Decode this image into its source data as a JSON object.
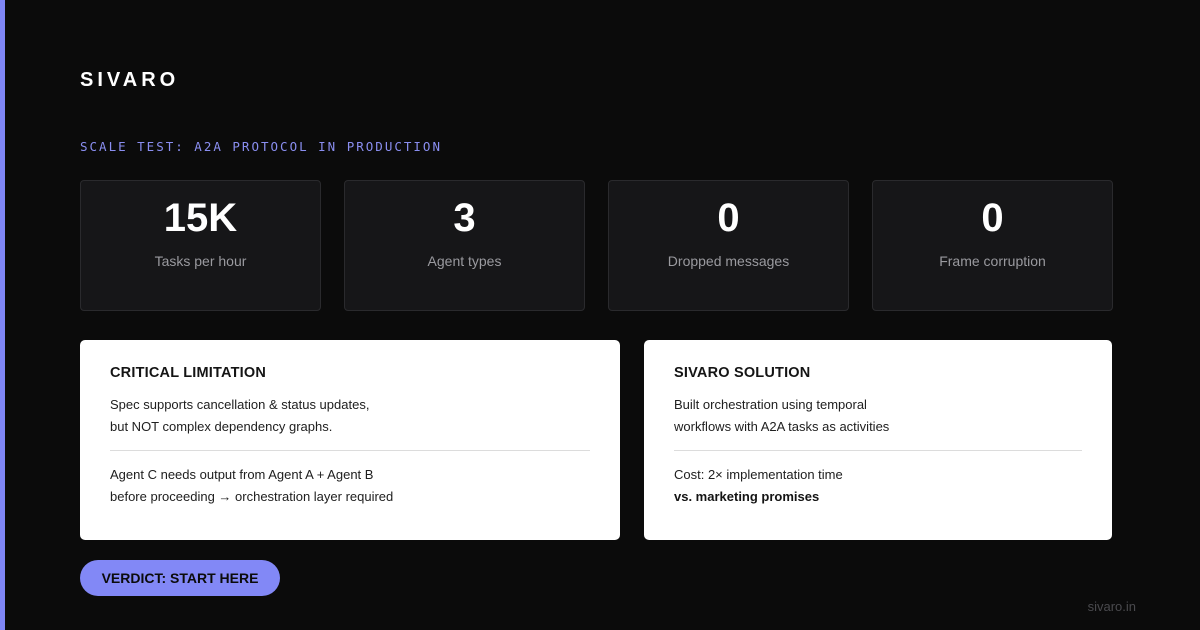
{
  "brand": "SIVARO",
  "subtitle": "SCALE TEST: A2A PROTOCOL IN PRODUCTION",
  "stats": [
    {
      "value": "15K",
      "label": "Tasks per hour"
    },
    {
      "value": "3",
      "label": "Agent types"
    },
    {
      "value": "0",
      "label": "Dropped messages"
    },
    {
      "value": "0",
      "label": "Frame corruption"
    }
  ],
  "left_card": {
    "title": "CRITICAL LIMITATION",
    "lines_top": [
      "Spec supports cancellation & status updates,",
      "but NOT complex dependency graphs."
    ],
    "lines_bottom": [
      "Agent C needs output from Agent A + Agent B",
      "before proceeding → orchestration layer required"
    ]
  },
  "right_card": {
    "title": "SIVARO SOLUTION",
    "lines_top": [
      "Built orchestration using temporal",
      "workflows with A2A tasks as activities"
    ],
    "lines_bottom": [
      "Cost: 2× implementation time",
      "vs. marketing promises"
    ]
  },
  "verdict_label": "VERDICT: START HERE",
  "footer_url": "sivaro.in",
  "colors": {
    "accent": "#7f86f5",
    "background": "#0b0b0b",
    "card_bg": "#161618",
    "button": "#8288f6"
  }
}
